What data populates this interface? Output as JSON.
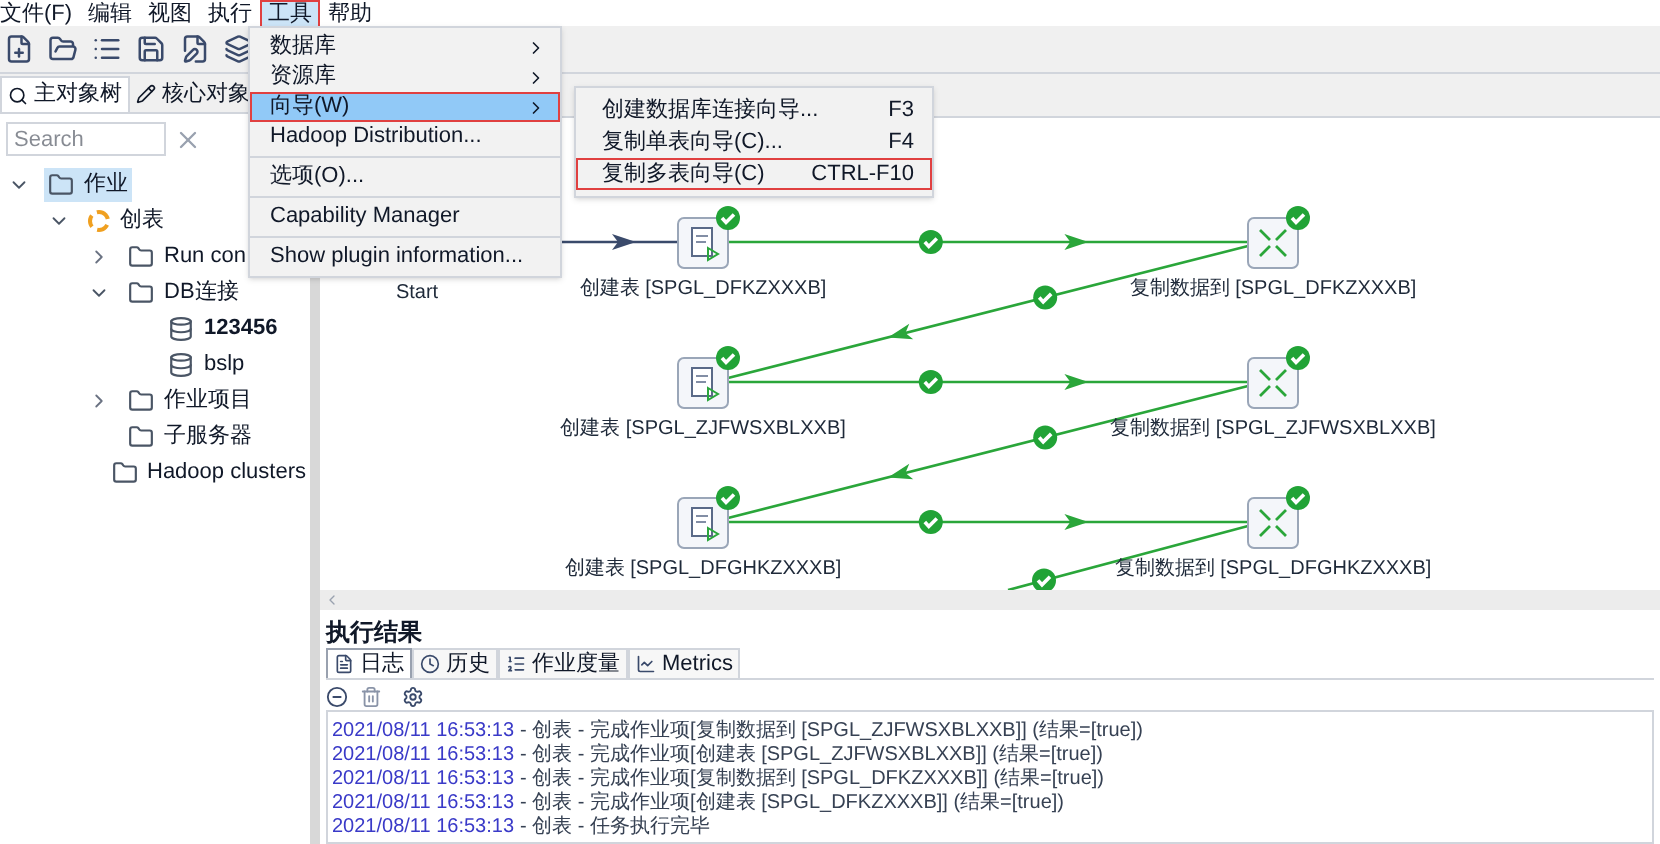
{
  "menu_bar": [
    {
      "label": "文件(F)",
      "selected": false
    },
    {
      "label": "编辑",
      "selected": false
    },
    {
      "label": "视图",
      "selected": false
    },
    {
      "label": "执行",
      "selected": false
    },
    {
      "label": "工具",
      "selected": true
    },
    {
      "label": "帮助",
      "selected": false
    }
  ],
  "tools_menu": [
    {
      "kind": "submenu",
      "label": "数据库",
      "selected": false,
      "outlined": false
    },
    {
      "kind": "submenu",
      "label": "资源库",
      "selected": false,
      "outlined": false
    },
    {
      "kind": "submenu",
      "label": "向导(W)",
      "selected": true,
      "outlined": true
    },
    {
      "kind": "item",
      "label": "Hadoop Distribution...",
      "selected": false,
      "outlined": false
    },
    {
      "kind": "separator"
    },
    {
      "kind": "item",
      "label": "选项(O)...",
      "selected": false,
      "outlined": false
    },
    {
      "kind": "separator"
    },
    {
      "kind": "item",
      "label": "Capability Manager",
      "selected": false,
      "outlined": false
    },
    {
      "kind": "separator"
    },
    {
      "kind": "item",
      "label": "Show plugin information...",
      "selected": false,
      "outlined": false
    }
  ],
  "wizard_submenu": [
    {
      "label": "创建数据库连接向导...",
      "shortcut": "F3",
      "outlined": false
    },
    {
      "label": "复制单表向导(C)...",
      "shortcut": "F4",
      "outlined": false
    },
    {
      "label": "复制多表向导(C)",
      "shortcut": "CTRL-F10",
      "outlined": true
    }
  ],
  "left_tabs": [
    {
      "label": "主对象树",
      "selected": true
    },
    {
      "label": "核心对象",
      "selected": false
    }
  ],
  "search": {
    "placeholder": "Search"
  },
  "tree": [
    {
      "label": "作业",
      "kind": "folder",
      "expanded": true,
      "selected": true,
      "bold": false,
      "children": [
        {
          "label": "创表",
          "kind": "job",
          "expanded": true,
          "selected": false,
          "bold": false,
          "children": [
            {
              "label": "Run con",
              "kind": "folder",
              "expanded": false,
              "selected": false,
              "bold": false
            },
            {
              "label": "DB连接",
              "kind": "folder",
              "expanded": true,
              "selected": false,
              "bold": false,
              "children": [
                {
                  "label": "123456",
                  "kind": "database",
                  "selected": false,
                  "bold": true
                },
                {
                  "label": "bslp",
                  "kind": "database",
                  "selected": false,
                  "bold": false
                }
              ]
            },
            {
              "label": "作业项目",
              "kind": "folder",
              "expanded": false,
              "selected": false,
              "bold": false
            },
            {
              "label": "子服务器",
              "kind": "folder",
              "selected": false,
              "bold": false
            },
            {
              "label": "Hadoop clusters",
              "kind": "folder",
              "selected": false,
              "bold": false
            }
          ]
        }
      ]
    }
  ],
  "diagram": {
    "nodes": [
      {
        "kind": "start",
        "label": "Start"
      },
      {
        "kind": "create",
        "label": "创建表 [SPGL_DFKZXXXB]",
        "succeeded": true
      },
      {
        "kind": "copy",
        "label": "复制数据到 [SPGL_DFKZXXXB]",
        "succeeded": true
      },
      {
        "kind": "create",
        "label": "创建表 [SPGL_ZJFWSXBLXXB]",
        "succeeded": true
      },
      {
        "kind": "copy",
        "label": "复制数据到 [SPGL_ZJFWSXBLXXB]",
        "succeeded": true
      },
      {
        "kind": "create",
        "label": "创建表 [SPGL_DFGHKZXXXB]",
        "succeeded": true
      },
      {
        "kind": "copy",
        "label": "复制数据到 [SPGL_DFGHKZXXXB]",
        "succeeded": true
      }
    ],
    "links": [
      {
        "kind": "plain"
      },
      {
        "kind": "flow",
        "succeeded": true
      },
      {
        "kind": "flow",
        "succeeded": true
      },
      {
        "kind": "flow",
        "succeeded": true
      },
      {
        "kind": "flow",
        "succeeded": true
      },
      {
        "kind": "flow",
        "succeeded": true
      },
      {
        "kind": "flow",
        "succeeded": true
      }
    ]
  },
  "results": {
    "title": "执行结果",
    "tabs": [
      {
        "label": "日志",
        "selected": true
      },
      {
        "label": "历史",
        "selected": false
      },
      {
        "label": "作业度量",
        "selected": false
      },
      {
        "label": "Metrics",
        "selected": false
      }
    ],
    "log": [
      {
        "time": "2021/08/11 16:53:13",
        "message": "- 创表 - 完成作业项[复制数据到 [SPGL_ZJFWSXBLXXB]] (结果=[true])"
      },
      {
        "time": "2021/08/11 16:53:13",
        "message": "- 创表 - 完成作业项[创建表 [SPGL_ZJFWSXBLXXB]] (结果=[true])"
      },
      {
        "time": "2021/08/11 16:53:13",
        "message": "- 创表 - 完成作业项[复制数据到 [SPGL_DFKZXXXB]] (结果=[true])"
      },
      {
        "time": "2021/08/11 16:53:13",
        "message": "- 创表 - 完成作业项[创建表 [SPGL_DFKZXXXB]] (结果=[true])"
      },
      {
        "time": "2021/08/11 16:53:13",
        "message": "- 创表 - 任务执行完毕"
      }
    ]
  }
}
